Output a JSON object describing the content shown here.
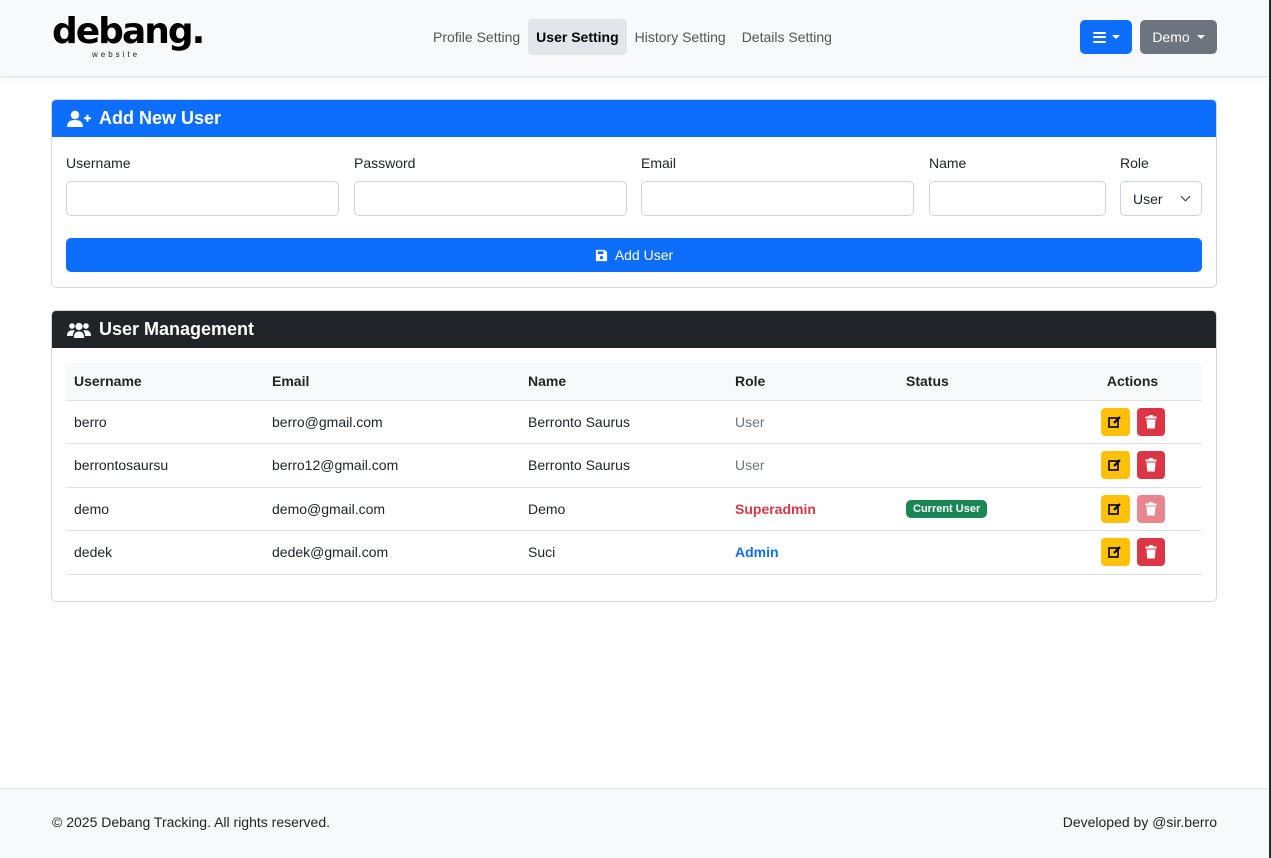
{
  "brand": {
    "name": "debang.",
    "sub": "website"
  },
  "nav": {
    "links": [
      "Profile Setting",
      "User Setting",
      "History Setting",
      "Details Setting"
    ],
    "active": "User Setting",
    "user_button": "Demo"
  },
  "add_user": {
    "title": "Add New User",
    "labels": {
      "username": "Username",
      "password": "Password",
      "email": "Email",
      "name": "Name",
      "role": "Role"
    },
    "values": {
      "username": "",
      "password": "",
      "email": "",
      "name": ""
    },
    "role_selected": "User",
    "submit_label": "Add User"
  },
  "user_management": {
    "title": "User Management",
    "columns": [
      "Username",
      "Email",
      "Name",
      "Role",
      "Status",
      "Actions"
    ],
    "rows": [
      {
        "username": "berro",
        "email": "berro@gmail.com",
        "name": "Berronto Saurus",
        "role": "User",
        "status": ""
      },
      {
        "username": "berrontosaursu",
        "email": "berro12@gmail.com",
        "name": "Berronto Saurus",
        "role": "User",
        "status": ""
      },
      {
        "username": "demo",
        "email": "demo@gmail.com",
        "name": "Demo",
        "role": "Superadmin",
        "status": "Current User"
      },
      {
        "username": "dedek",
        "email": "dedek@gmail.com",
        "name": "Suci",
        "role": "Admin",
        "status": ""
      }
    ]
  },
  "footer": {
    "copyright": "© 2025 Debang Tracking. All rights reserved.",
    "credit": "Developed by @sir.berro"
  },
  "colors": {
    "primary": "#0d6efd",
    "dark": "#212529",
    "warning": "#ffc107",
    "danger": "#dc3545",
    "success": "#198754",
    "secondary": "#6c757d"
  },
  "icons": {
    "add_user": "user-plus-icon",
    "users": "users-icon",
    "save": "save-icon",
    "edit": "edit-icon",
    "delete": "trash-icon",
    "menu": "bars-icon"
  }
}
